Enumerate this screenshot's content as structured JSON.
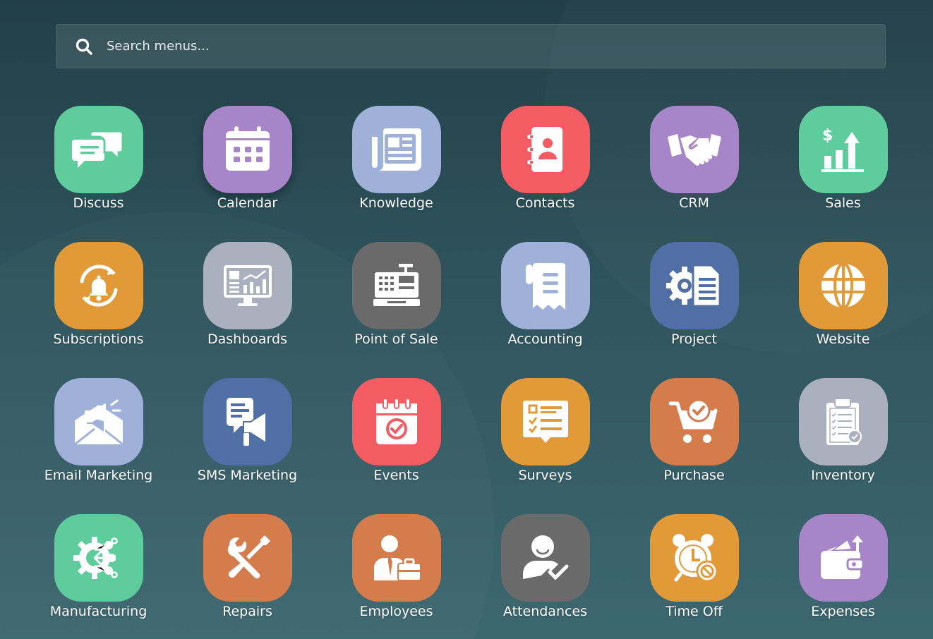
{
  "search": {
    "placeholder": "Search menus..."
  },
  "apps": [
    {
      "label": "Discuss",
      "icon": "chat-bubbles-icon",
      "color": "#5fcc9e"
    },
    {
      "label": "Calendar",
      "icon": "calendar-icon",
      "color": "#a686c8"
    },
    {
      "label": "Knowledge",
      "icon": "newspaper-icon",
      "color": "#9fb1d8"
    },
    {
      "label": "Contacts",
      "icon": "address-book-icon",
      "color": "#f25c62"
    },
    {
      "label": "CRM",
      "icon": "handshake-icon",
      "color": "#a686c8"
    },
    {
      "label": "Sales",
      "icon": "sales-chart-icon",
      "color": "#5fcc9e"
    },
    {
      "label": "Subscriptions",
      "icon": "bell-refresh-icon",
      "color": "#e19a37"
    },
    {
      "label": "Dashboards",
      "icon": "monitor-chart-icon",
      "color": "#aab0bd"
    },
    {
      "label": "Point of Sale",
      "icon": "cash-register-icon",
      "color": "#6a6a6a"
    },
    {
      "label": "Accounting",
      "icon": "receipt-icon",
      "color": "#9fb1d8"
    },
    {
      "label": "Project",
      "icon": "gear-document-icon",
      "color": "#4f6fa5"
    },
    {
      "label": "Website",
      "icon": "globe-icon",
      "color": "#e19a37"
    },
    {
      "label": "Email Marketing",
      "icon": "envelope-megaphone-icon",
      "color": "#9fb1d8"
    },
    {
      "label": "SMS Marketing",
      "icon": "phone-megaphone-icon",
      "color": "#4f6fa5"
    },
    {
      "label": "Events",
      "icon": "calendar-check-icon",
      "color": "#f25c62"
    },
    {
      "label": "Surveys",
      "icon": "survey-checklist-icon",
      "color": "#e19a37"
    },
    {
      "label": "Purchase",
      "icon": "shopping-cart-icon",
      "color": "#d47c4c"
    },
    {
      "label": "Inventory",
      "icon": "clipboard-check-icon",
      "color": "#aab0bd"
    },
    {
      "label": "Manufacturing",
      "icon": "gear-circuit-icon",
      "color": "#5fcc9e"
    },
    {
      "label": "Repairs",
      "icon": "wrench-screwdriver-icon",
      "color": "#d47c4c"
    },
    {
      "label": "Employees",
      "icon": "employee-briefcase-icon",
      "color": "#d47c4c"
    },
    {
      "label": "Attendances",
      "icon": "user-check-icon",
      "color": "#6a6a6a"
    },
    {
      "label": "Time Off",
      "icon": "alarm-clock-icon",
      "color": "#e19a37"
    },
    {
      "label": "Expenses",
      "icon": "wallet-icon",
      "color": "#a686c8"
    }
  ]
}
